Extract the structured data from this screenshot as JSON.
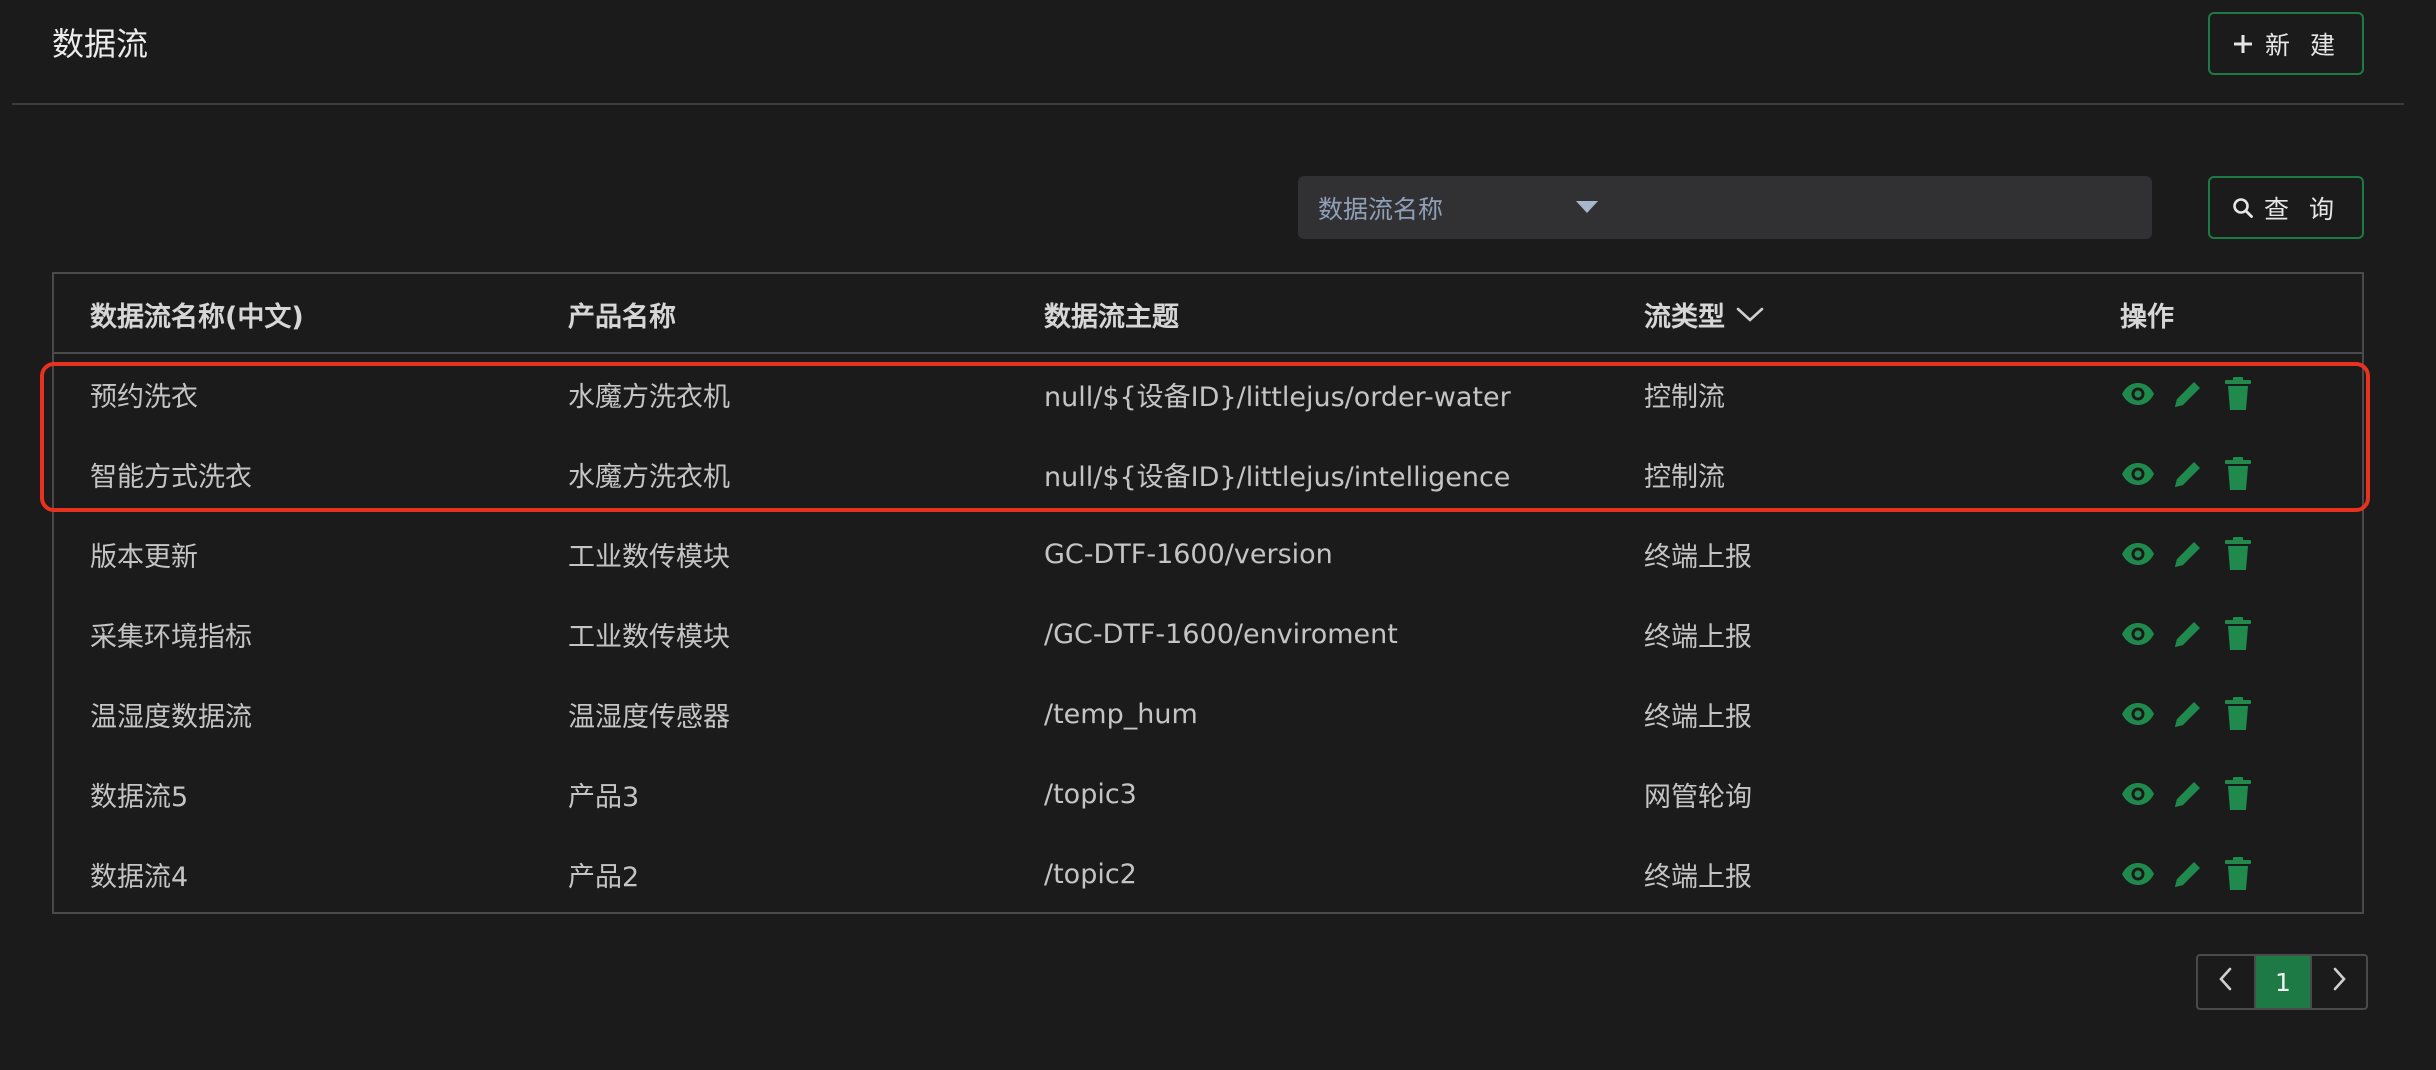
{
  "header": {
    "title": "数据流",
    "new_button": "新 建"
  },
  "filter": {
    "field_label": "数据流名称",
    "input_placeholder": "",
    "search_button": "查 询"
  },
  "table": {
    "columns": [
      "数据流名称(中文)",
      "产品名称",
      "数据流主题",
      "流类型",
      "操作"
    ],
    "rows": [
      {
        "name": "预约洗衣",
        "product": "水魔方洗衣机",
        "topic": "null/${设备ID}/littlejus/order-water",
        "type": "控制流"
      },
      {
        "name": "智能方式洗衣",
        "product": "水魔方洗衣机",
        "topic": "null/${设备ID}/littlejus/intelligence",
        "type": "控制流"
      },
      {
        "name": "版本更新",
        "product": "工业数传模块",
        "topic": "GC-DTF-1600/version",
        "type": "终端上报"
      },
      {
        "name": "采集环境指标",
        "product": "工业数传模块",
        "topic": "/GC-DTF-1600/enviroment",
        "type": "终端上报"
      },
      {
        "name": "温湿度数据流",
        "product": "温湿度传感器",
        "topic": "/temp_hum",
        "type": "终端上报"
      },
      {
        "name": "数据流5",
        "product": "产品3",
        "topic": "/topic3",
        "type": "网管轮询"
      },
      {
        "name": "数据流4",
        "product": "产品2",
        "topic": "/topic2",
        "type": "终端上报"
      }
    ]
  },
  "pagination": {
    "current_page": "1"
  },
  "icons": {
    "new": "plus-icon",
    "search": "search-icon",
    "sort": "chevron-down-icon",
    "view": "eye-icon",
    "edit": "pencil-icon",
    "delete": "trash-icon",
    "prev": "chevron-left-icon",
    "next": "chevron-right-icon"
  },
  "colors": {
    "accent": "#1d7a45",
    "action_icon": "#1f8a4c",
    "highlight": "#e8321e",
    "background": "#1b1b1c"
  }
}
